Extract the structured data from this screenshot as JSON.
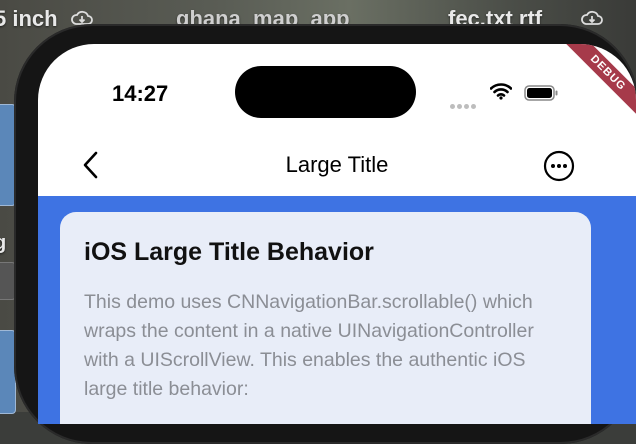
{
  "desktop": {
    "labels": [
      "5 inch",
      "ghana_map_app",
      "fec.txt rtf"
    ],
    "side_letter": "g"
  },
  "status_bar": {
    "time": "14:27"
  },
  "debug_banner": "DEBUG",
  "nav": {
    "title": "Large Title",
    "back_icon": "chevron-left-icon",
    "more_icon": "ellipsis-circle-icon"
  },
  "card": {
    "title": "iOS Large Title Behavior",
    "body": "This demo uses CNNavigationBar.scrollable() which wraps the content in a native UINavigationController with a UIScrollView. This enables the authentic iOS large title behavior:"
  },
  "colors": {
    "content_bg": "#3e73e3",
    "card_bg": "#e8edf8",
    "debug_ribbon": "#a63a4a"
  }
}
